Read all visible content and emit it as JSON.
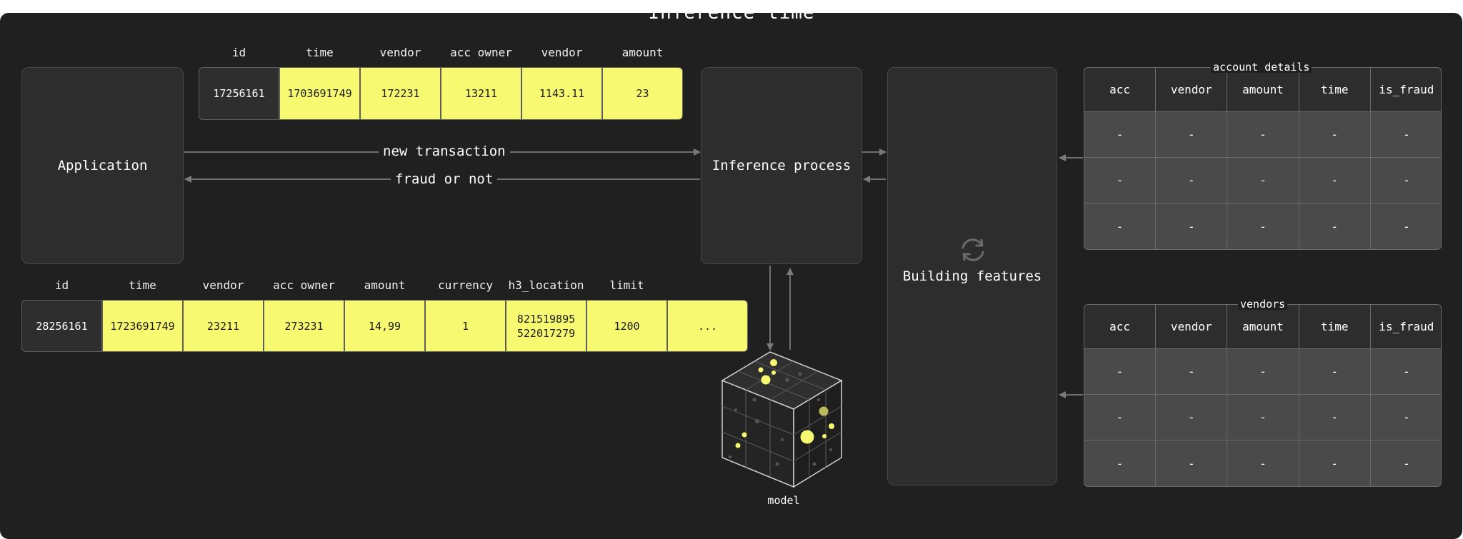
{
  "title": "Inference time",
  "application": {
    "label": "Application"
  },
  "inference": {
    "label": "Inference process"
  },
  "features": {
    "label": "Building features"
  },
  "model": {
    "label": "model"
  },
  "edges": {
    "request": "new transaction",
    "response": "fraud or not"
  },
  "top_record": {
    "headers": [
      "id",
      "time",
      "vendor",
      "acc owner",
      "vendor",
      "amount"
    ],
    "values": [
      "17256161",
      "1703691749",
      "172231",
      "13211",
      "1143.11",
      "23"
    ]
  },
  "bottom_record": {
    "headers": [
      "id",
      "time",
      "vendor",
      "acc owner",
      "amount",
      "currency",
      "h3_location",
      "limit"
    ],
    "values": [
      "28256161",
      "1723691749",
      "23211",
      "273231",
      "14,99",
      "1",
      "821519895\n522017279",
      "1200",
      "..."
    ]
  },
  "account_table": {
    "title": "account details",
    "headers": [
      "acc",
      "vendor",
      "amount",
      "time",
      "is_fraud"
    ],
    "rows": [
      [
        "-",
        "-",
        "-",
        "-",
        "-"
      ],
      [
        "-",
        "-",
        "-",
        "-",
        "-"
      ],
      [
        "-",
        "-",
        "-",
        "-",
        "-"
      ]
    ]
  },
  "vendors_table": {
    "title": "vendors",
    "headers": [
      "acc",
      "vendor",
      "amount",
      "time",
      "is_fraud"
    ],
    "rows": [
      [
        "-",
        "-",
        "-",
        "-",
        "-"
      ],
      [
        "-",
        "-",
        "-",
        "-",
        "-"
      ],
      [
        "-",
        "-",
        "-",
        "-",
        "-"
      ]
    ]
  },
  "colors": {
    "background": "#202020",
    "accent": "#f7fa70",
    "node": "#2d2d2d",
    "edge": "#6f6f6f"
  }
}
